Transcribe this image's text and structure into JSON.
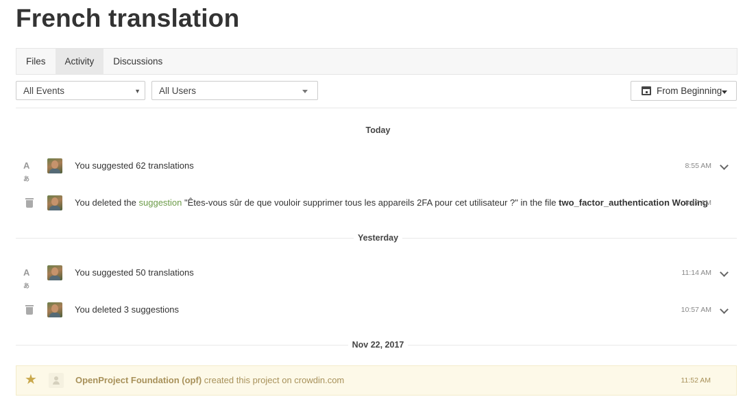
{
  "page": {
    "title": "French translation"
  },
  "tabs": [
    {
      "label": "Files"
    },
    {
      "label": "Activity",
      "active": true
    },
    {
      "label": "Discussions"
    }
  ],
  "filters": {
    "events": "All Events",
    "users": "All Users",
    "date": "From Beginning"
  },
  "groups": [
    {
      "day": "Today",
      "items": [
        {
          "icon": "translate-icon",
          "text": "You suggested 62 translations",
          "time": "8:55 AM",
          "expandable": true
        },
        {
          "icon": "trash-icon",
          "prefix": "You deleted the ",
          "link": "suggestion",
          "middle": " \"Êtes-vous sûr de que vouloir supprimer tous les appareils 2FA pour cet utilisateur ?\" in the file ",
          "bold": "two_factor_authentication Wording",
          "time": "8:47 AM",
          "expandable": false
        }
      ]
    },
    {
      "day": "Yesterday",
      "items": [
        {
          "icon": "translate-icon",
          "text": "You suggested 50 translations",
          "time": "11:14 AM",
          "expandable": true
        },
        {
          "icon": "trash-icon",
          "text": "You deleted 3 suggestions",
          "time": "10:57 AM",
          "expandable": true
        }
      ]
    },
    {
      "day": "Nov 22, 2017",
      "project": {
        "icon": "star-icon",
        "actor": "OpenProject Foundation (opf)",
        "text": " created this project on crowdin.com",
        "time": "11:52 AM"
      }
    }
  ],
  "colors": {
    "link": "#6c9b48",
    "highlight_bg": "#fdf9e8",
    "highlight_text": "#a8915a"
  }
}
